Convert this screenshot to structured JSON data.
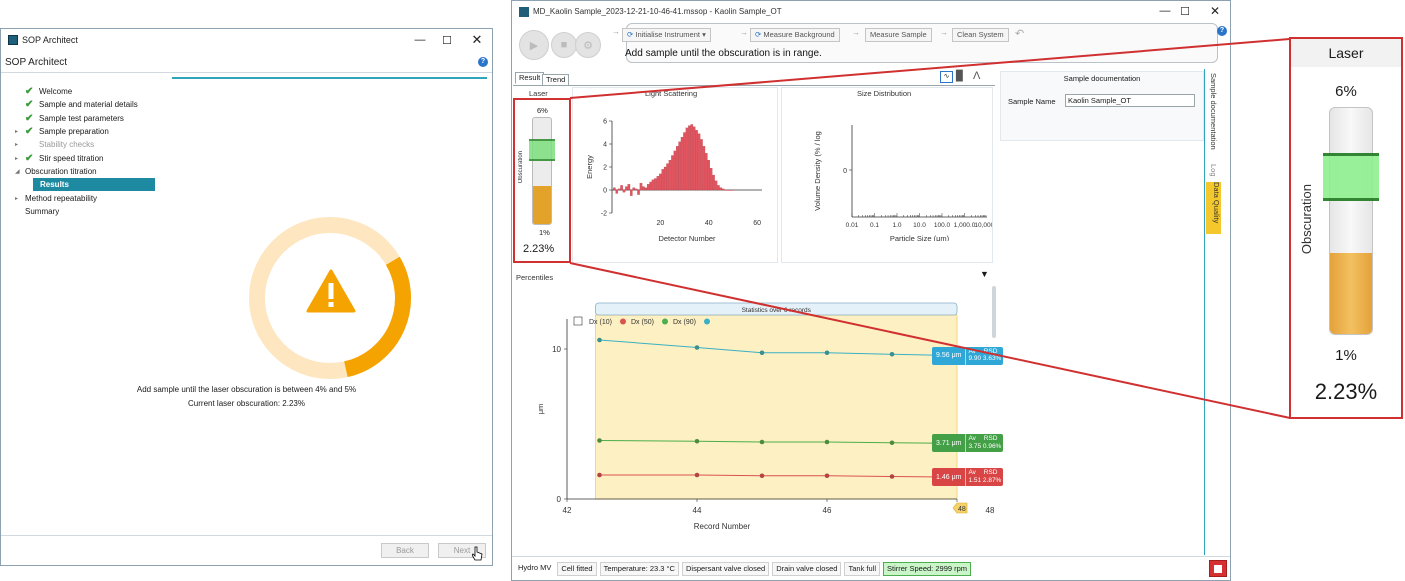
{
  "sop_window": {
    "title": "SOP Architect",
    "header_title": "SOP Architect",
    "nav": [
      {
        "label": "Welcome",
        "state": "done"
      },
      {
        "label": "Sample and material details",
        "state": "done"
      },
      {
        "label": "Sample test parameters",
        "state": "done"
      },
      {
        "label": "Sample preparation",
        "state": "done-expand"
      },
      {
        "label": "Stability checks",
        "state": "disabled-expand"
      },
      {
        "label": "Stir speed titration",
        "state": "done-expand"
      },
      {
        "label": "Obscuration titration",
        "state": "open"
      },
      {
        "label": "Results",
        "state": "selected"
      },
      {
        "label": "Method repeatability",
        "state": "expand"
      },
      {
        "label": "Summary",
        "state": "plain"
      }
    ],
    "progress_fraction": 0.3,
    "message_line1": "Add sample until the laser obscuration is between 4% and 5%",
    "message_line2": "Current laser obscuration: 2.23%",
    "back_label": "Back",
    "next_label": "Next",
    "colors": {
      "accent": "#f5a300",
      "ring_bg": "#fde6c0",
      "rule": "#2fa4bd",
      "selected": "#1e8aa2"
    }
  },
  "ms_window": {
    "title": "MD_Kaolin Sample_2023-12-21-10-46-41.mssop - Kaolin Sample_OT",
    "steps": [
      "Initialise Instrument",
      "Measure Background",
      "Measure Sample",
      "Clean System"
    ],
    "instruction": "Add sample until the obscuration is in range.",
    "tabs": [
      "Result",
      "Trend"
    ],
    "laser": {
      "title": "Laser",
      "top_pct": "6%",
      "bottom_pct": "1%",
      "value": "2.23%",
      "axis": "Obscuration",
      "level_fraction": 0.36
    },
    "light_scattering": {
      "title": "Light Scattering",
      "xlabel": "Detector Number",
      "ylabel": "Energy",
      "x_ticks": [
        "20",
        "40",
        "60"
      ],
      "y_ticks": [
        "6",
        "4",
        "2",
        "0",
        "-2"
      ]
    },
    "size_distribution": {
      "title": "Size Distribution",
      "xlabel": "Particle Size (μm)",
      "ylabel": "Volume Density (% / log",
      "x_ticks": [
        "0.01",
        "0.1",
        "1.0",
        "10.0",
        "100.0",
        "1,000.0",
        "10,000.0"
      ],
      "y_ticks": [
        "0"
      ]
    },
    "percentiles_label": "Percentiles",
    "stats_header": "Statistics over 6 records",
    "legend": [
      {
        "name": "Dx (10)",
        "color": "#d9534f"
      },
      {
        "name": "Dx (50)",
        "color": "#4cae4c"
      },
      {
        "name": "Dx (90)",
        "color": "#3ab0c5"
      }
    ],
    "trend_xlabel": "Record Number",
    "trend_ylabel": "μm",
    "trend_x_ticks": [
      "42",
      "44",
      "46",
      "48"
    ],
    "trend_y_ticks": [
      "10",
      "0"
    ],
    "trend_marker": "48",
    "badges": [
      {
        "value": "9.56 μm",
        "av": "Av",
        "av_val": "9.90",
        "rsd": "RSD",
        "rsd_val": "3.63%",
        "color": "#2fa8d8"
      },
      {
        "value": "3.71 μm",
        "av": "Av",
        "av_val": "3.75",
        "rsd": "RSD",
        "rsd_val": "0.96%",
        "color": "#43a047"
      },
      {
        "value": "1.46 μm",
        "av": "Av",
        "av_val": "1.51",
        "rsd": "RSD",
        "rsd_val": "2.87%",
        "color": "#d94545"
      }
    ],
    "sample_doc_title": "Sample documentation",
    "sample_name_label": "Sample Name",
    "sample_name_value": "Kaolin Sample_OT",
    "side_tabs": [
      "Sample documentation",
      "Log",
      "Data Quality"
    ],
    "status": [
      "Hydro MV",
      "Cell fitted",
      "Temperature: 23.3 °C",
      "Dispersant valve closed",
      "Drain valve closed",
      "Tank full",
      "Stirrer Speed: 2999 rpm"
    ]
  },
  "chart_data": [
    {
      "type": "bar",
      "title": "Light Scattering",
      "xlabel": "Detector Number",
      "ylabel": "Energy",
      "xlim": [
        0,
        62
      ],
      "ylim": [
        -2,
        6
      ],
      "x": [
        1,
        2,
        3,
        4,
        5,
        6,
        7,
        8,
        9,
        10,
        11,
        12,
        13,
        14,
        15,
        16,
        17,
        18,
        19,
        20,
        21,
        22,
        23,
        24,
        25,
        26,
        27,
        28,
        29,
        30,
        31,
        32,
        33,
        34,
        35,
        36,
        37,
        38,
        39,
        40,
        41,
        42,
        43,
        44,
        45,
        46,
        47,
        48,
        49,
        50
      ],
      "values": [
        0.2,
        -0.3,
        0.1,
        0.4,
        -0.2,
        0.3,
        0.5,
        -0.5,
        0.2,
        0.1,
        -0.4,
        0.6,
        0.3,
        0.2,
        0.5,
        0.7,
        0.9,
        1.0,
        1.2,
        1.4,
        1.8,
        2.0,
        2.3,
        2.6,
        3.0,
        3.4,
        3.8,
        4.2,
        4.6,
        5.0,
        5.4,
        5.6,
        5.7,
        5.5,
        5.2,
        4.9,
        4.4,
        3.8,
        3.2,
        2.6,
        1.9,
        1.3,
        0.8,
        0.4,
        0.2,
        0.1,
        0.0,
        0.0,
        0.0,
        0.0
      ],
      "color": "#e05560"
    },
    {
      "type": "line",
      "title": "Statistics over 6 records",
      "xlabel": "Record Number",
      "ylabel": "μm",
      "xlim": [
        42,
        48
      ],
      "ylim": [
        0,
        12
      ],
      "x": [
        42.5,
        44,
        45,
        46,
        47,
        48
      ],
      "series": [
        {
          "name": "Dx (10)",
          "values": [
            1.6,
            1.6,
            1.55,
            1.55,
            1.5,
            1.46
          ],
          "color": "#d9534f"
        },
        {
          "name": "Dx (50)",
          "values": [
            3.9,
            3.85,
            3.8,
            3.8,
            3.75,
            3.71
          ],
          "color": "#4cae4c"
        },
        {
          "name": "Dx (90)",
          "values": [
            10.6,
            10.1,
            9.75,
            9.75,
            9.65,
            9.56
          ],
          "color": "#3ab0c5"
        }
      ]
    }
  ],
  "zoom": {
    "title": "Laser",
    "top_pct": "6%",
    "bottom_pct": "1%",
    "value": "2.23%",
    "axis": "Obscuration"
  }
}
